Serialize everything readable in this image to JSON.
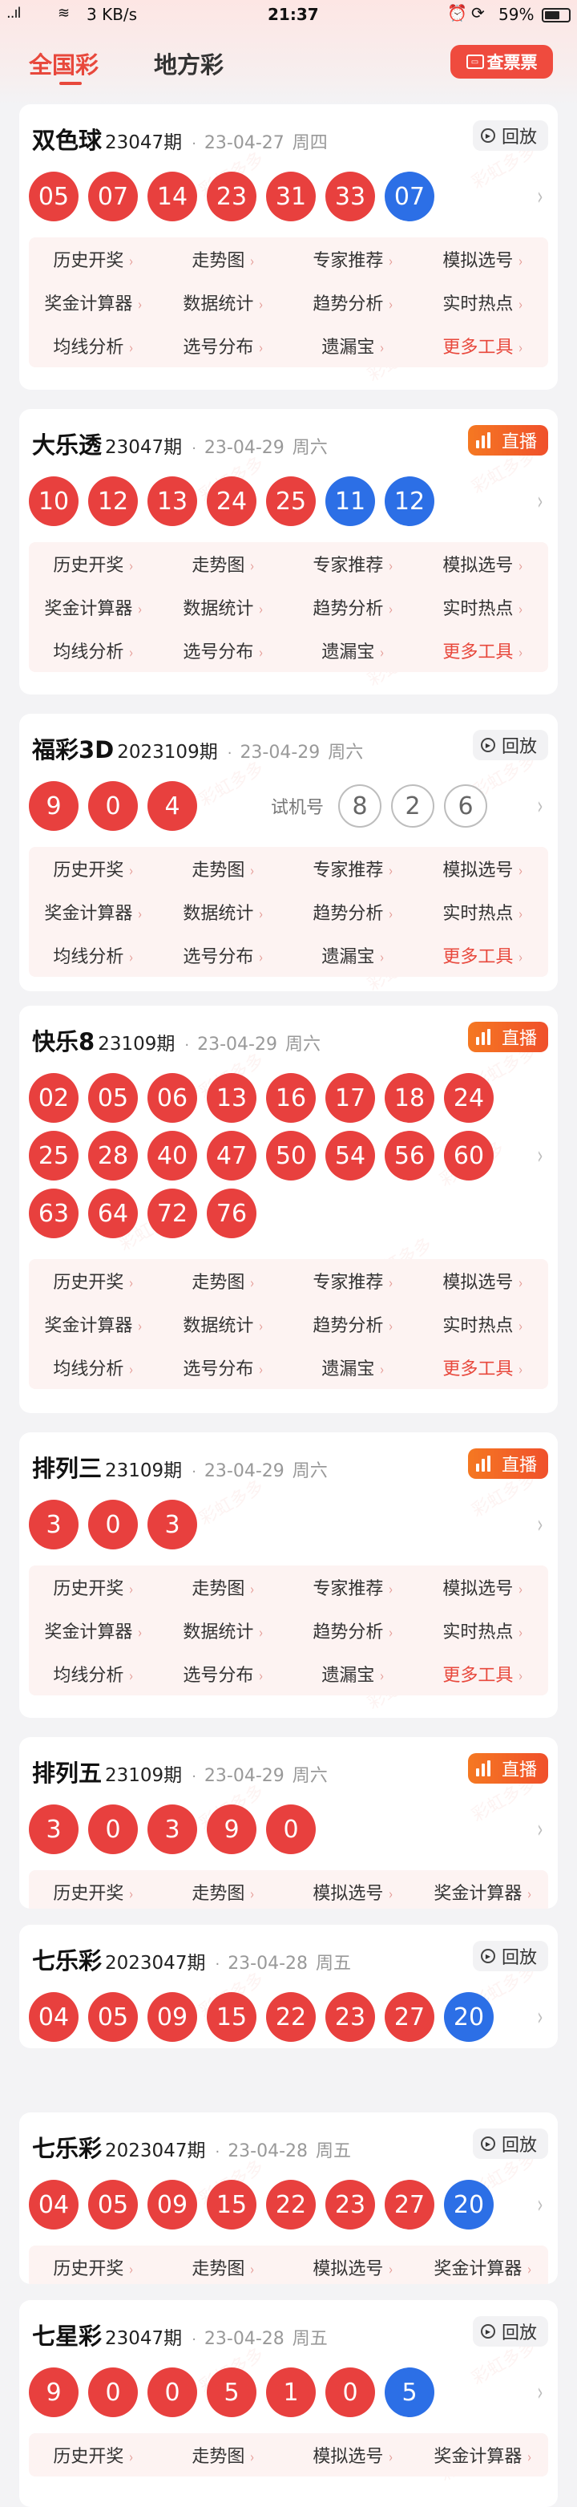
{
  "status_bar": {
    "signal": "..ıl",
    "network_speed": "3 KB/s",
    "time": "21:37",
    "battery": "59%"
  },
  "tabs": [
    {
      "label": "全国彩"
    },
    {
      "label": "地方彩"
    }
  ],
  "ticket_button": {
    "label": "查票票"
  },
  "watermark": "彩虹多多",
  "cards": [
    {
      "name": "双色球",
      "issue": "23047期",
      "date": "23-04-27",
      "weekday": "周四",
      "action": "回放",
      "balls": [
        [
          "05",
          "red"
        ],
        [
          "07",
          "red"
        ],
        [
          "14",
          "red"
        ],
        [
          "23",
          "red"
        ],
        [
          "31",
          "red"
        ],
        [
          "33",
          "red"
        ],
        [
          "07",
          "blue"
        ]
      ],
      "links": [
        [
          "历史开奖",
          "走势图",
          "专家推荐",
          "模拟选号"
        ],
        [
          "奖金计算器",
          "数据统计",
          "趋势分析",
          "实时热点"
        ],
        [
          "均线分析",
          "选号分布",
          "遗漏宝",
          "更多工具"
        ]
      ]
    },
    {
      "name": "大乐透",
      "issue": "23047期",
      "date": "23-04-29",
      "weekday": "周六",
      "action": "直播",
      "balls": [
        [
          "10",
          "red"
        ],
        [
          "12",
          "red"
        ],
        [
          "13",
          "red"
        ],
        [
          "24",
          "red"
        ],
        [
          "25",
          "red"
        ],
        [
          "11",
          "blue"
        ],
        [
          "12",
          "blue"
        ]
      ],
      "links": [
        [
          "历史开奖",
          "走势图",
          "专家推荐",
          "模拟选号"
        ],
        [
          "奖金计算器",
          "数据统计",
          "趋势分析",
          "实时热点"
        ],
        [
          "均线分析",
          "选号分布",
          "遗漏宝",
          "更多工具"
        ]
      ]
    },
    {
      "name": "福彩3D",
      "issue": "2023109期",
      "date": "23-04-29",
      "weekday": "周六",
      "action": "回放",
      "balls": [
        [
          "9",
          "red"
        ],
        [
          "0",
          "red"
        ],
        [
          "4",
          "red"
        ]
      ],
      "trial_label": "试机号",
      "trial": [
        "8",
        "2",
        "6"
      ],
      "links": [
        [
          "历史开奖",
          "走势图",
          "专家推荐",
          "模拟选号"
        ],
        [
          "奖金计算器",
          "数据统计",
          "趋势分析",
          "实时热点"
        ],
        [
          "均线分析",
          "选号分布",
          "遗漏宝",
          "更多工具"
        ]
      ]
    },
    {
      "name": "快乐8",
      "issue": "23109期",
      "date": "23-04-29",
      "weekday": "周六",
      "action": "直播",
      "balls": [
        [
          "02",
          "red"
        ],
        [
          "05",
          "red"
        ],
        [
          "06",
          "red"
        ],
        [
          "13",
          "red"
        ],
        [
          "16",
          "red"
        ],
        [
          "17",
          "red"
        ],
        [
          "18",
          "red"
        ],
        [
          "24",
          "red"
        ],
        [
          "25",
          "red"
        ],
        [
          "28",
          "red"
        ],
        [
          "40",
          "red"
        ],
        [
          "47",
          "red"
        ],
        [
          "50",
          "red"
        ],
        [
          "54",
          "red"
        ],
        [
          "56",
          "red"
        ],
        [
          "60",
          "red"
        ],
        [
          "63",
          "red"
        ],
        [
          "64",
          "red"
        ],
        [
          "72",
          "red"
        ],
        [
          "76",
          "red"
        ]
      ],
      "links": [
        [
          "历史开奖",
          "走势图",
          "专家推荐",
          "模拟选号"
        ],
        [
          "奖金计算器",
          "数据统计",
          "趋势分析",
          "实时热点"
        ],
        [
          "均线分析",
          "选号分布",
          "遗漏宝",
          "更多工具"
        ]
      ]
    },
    {
      "name": "排列三",
      "issue": "23109期",
      "date": "23-04-29",
      "weekday": "周六",
      "action": "直播",
      "balls": [
        [
          "3",
          "red"
        ],
        [
          "0",
          "red"
        ],
        [
          "3",
          "red"
        ]
      ],
      "links": [
        [
          "历史开奖",
          "走势图",
          "专家推荐",
          "模拟选号"
        ],
        [
          "奖金计算器",
          "数据统计",
          "趋势分析",
          "实时热点"
        ],
        [
          "均线分析",
          "选号分布",
          "遗漏宝",
          "更多工具"
        ]
      ]
    },
    {
      "name": "排列五",
      "issue": "23109期",
      "date": "23-04-29",
      "weekday": "周六",
      "action": "直播",
      "balls": [
        [
          "3",
          "red"
        ],
        [
          "0",
          "red"
        ],
        [
          "3",
          "red"
        ],
        [
          "9",
          "red"
        ],
        [
          "0",
          "red"
        ]
      ],
      "links": [
        [
          "历史开奖",
          "走势图",
          "模拟选号",
          "奖金计算器"
        ]
      ]
    },
    {
      "name": "七乐彩",
      "issue": "2023047期",
      "date": "23-04-28",
      "weekday": "周五",
      "action": "回放",
      "balls": [
        [
          "04",
          "red"
        ],
        [
          "05",
          "red"
        ],
        [
          "09",
          "red"
        ],
        [
          "15",
          "red"
        ],
        [
          "22",
          "red"
        ],
        [
          "23",
          "red"
        ],
        [
          "27",
          "red"
        ],
        [
          "20",
          "blue"
        ]
      ],
      "links": []
    },
    {
      "name": "七乐彩",
      "issue": "2023047期",
      "date": "23-04-28",
      "weekday": "周五",
      "action": "回放",
      "balls": [
        [
          "04",
          "red"
        ],
        [
          "05",
          "red"
        ],
        [
          "09",
          "red"
        ],
        [
          "15",
          "red"
        ],
        [
          "22",
          "red"
        ],
        [
          "23",
          "red"
        ],
        [
          "27",
          "red"
        ],
        [
          "20",
          "blue"
        ]
      ],
      "links": [
        [
          "历史开奖",
          "走势图",
          "模拟选号",
          "奖金计算器"
        ]
      ]
    },
    {
      "name": "七星彩",
      "issue": "23047期",
      "date": "23-04-28",
      "weekday": "周五",
      "action": "回放",
      "balls": [
        [
          "9",
          "red"
        ],
        [
          "0",
          "red"
        ],
        [
          "0",
          "red"
        ],
        [
          "5",
          "red"
        ],
        [
          "1",
          "red"
        ],
        [
          "0",
          "red"
        ],
        [
          "5",
          "blue"
        ]
      ],
      "links": [
        [
          "历史开奖",
          "走势图",
          "模拟选号",
          "奖金计算器"
        ]
      ]
    }
  ],
  "colors": {
    "accent": "#e8483c",
    "red_ball": "#e8403e",
    "blue_ball": "#2c6fe6",
    "live_badge": "#f3642a"
  }
}
